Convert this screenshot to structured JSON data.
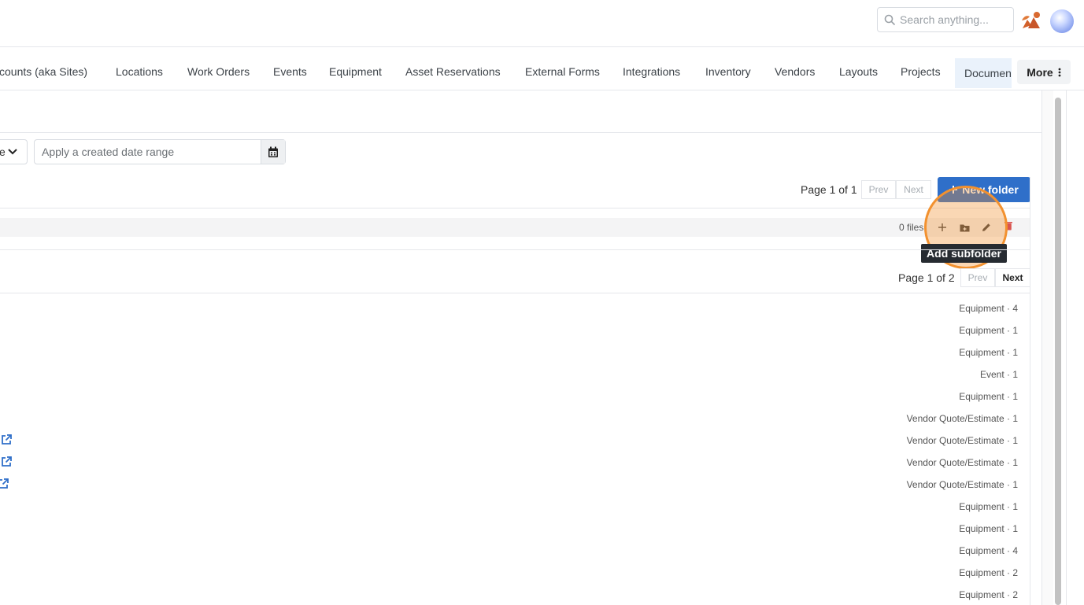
{
  "header": {
    "search_placeholder": "Search anything...",
    "icons": {
      "search": "search-icon",
      "brand": "brand-logo-icon",
      "avatar": "user-avatar"
    }
  },
  "nav": {
    "items": [
      {
        "label": "ccounts (aka Sites)"
      },
      {
        "label": "Locations"
      },
      {
        "label": "Work Orders"
      },
      {
        "label": "Events"
      },
      {
        "label": "Equipment"
      },
      {
        "label": "Asset Reservations"
      },
      {
        "label": "External Forms"
      },
      {
        "label": "Integrations"
      },
      {
        "label": "Inventory"
      },
      {
        "label": "Vendors"
      },
      {
        "label": "Layouts"
      },
      {
        "label": "Projects"
      },
      {
        "label": "Documen"
      }
    ],
    "more_label": "More"
  },
  "filters": {
    "select_value": "e",
    "date_placeholder": "Apply a created date range"
  },
  "folders_pager": {
    "text": "Page 1 of 1",
    "prev": "Prev",
    "next": "Next"
  },
  "new_folder_label": "New folder",
  "folder_row": {
    "files": "0 files"
  },
  "tooltip": "Add subfolder",
  "docs_pager": {
    "text": "Page 1 of 2",
    "prev": "Prev",
    "next": "Next"
  },
  "documents": [
    {
      "label": "Equipment · 4",
      "link": false
    },
    {
      "label": "Equipment · 1",
      "link": false
    },
    {
      "label": "Equipment · 1",
      "link": false
    },
    {
      "label": "Event · 1",
      "link": false
    },
    {
      "label": "Equipment · 1",
      "link": false
    },
    {
      "label": "Vendor Quote/Estimate · 1",
      "link": false
    },
    {
      "label": "Vendor Quote/Estimate · 1",
      "link": true
    },
    {
      "label": "Vendor Quote/Estimate · 1",
      "link": true
    },
    {
      "label": "Vendor Quote/Estimate · 1",
      "link": true
    },
    {
      "label": "Equipment · 1",
      "link": false
    },
    {
      "label": "Equipment · 1",
      "link": false
    },
    {
      "label": "Equipment · 4",
      "link": false
    },
    {
      "label": "Equipment · 2",
      "link": false
    },
    {
      "label": "Equipment · 2",
      "link": false
    }
  ],
  "colors": {
    "primary": "#2f6fc9",
    "highlight": "#f2912f",
    "delete": "#d9534f",
    "link": "#2f6fc9"
  }
}
